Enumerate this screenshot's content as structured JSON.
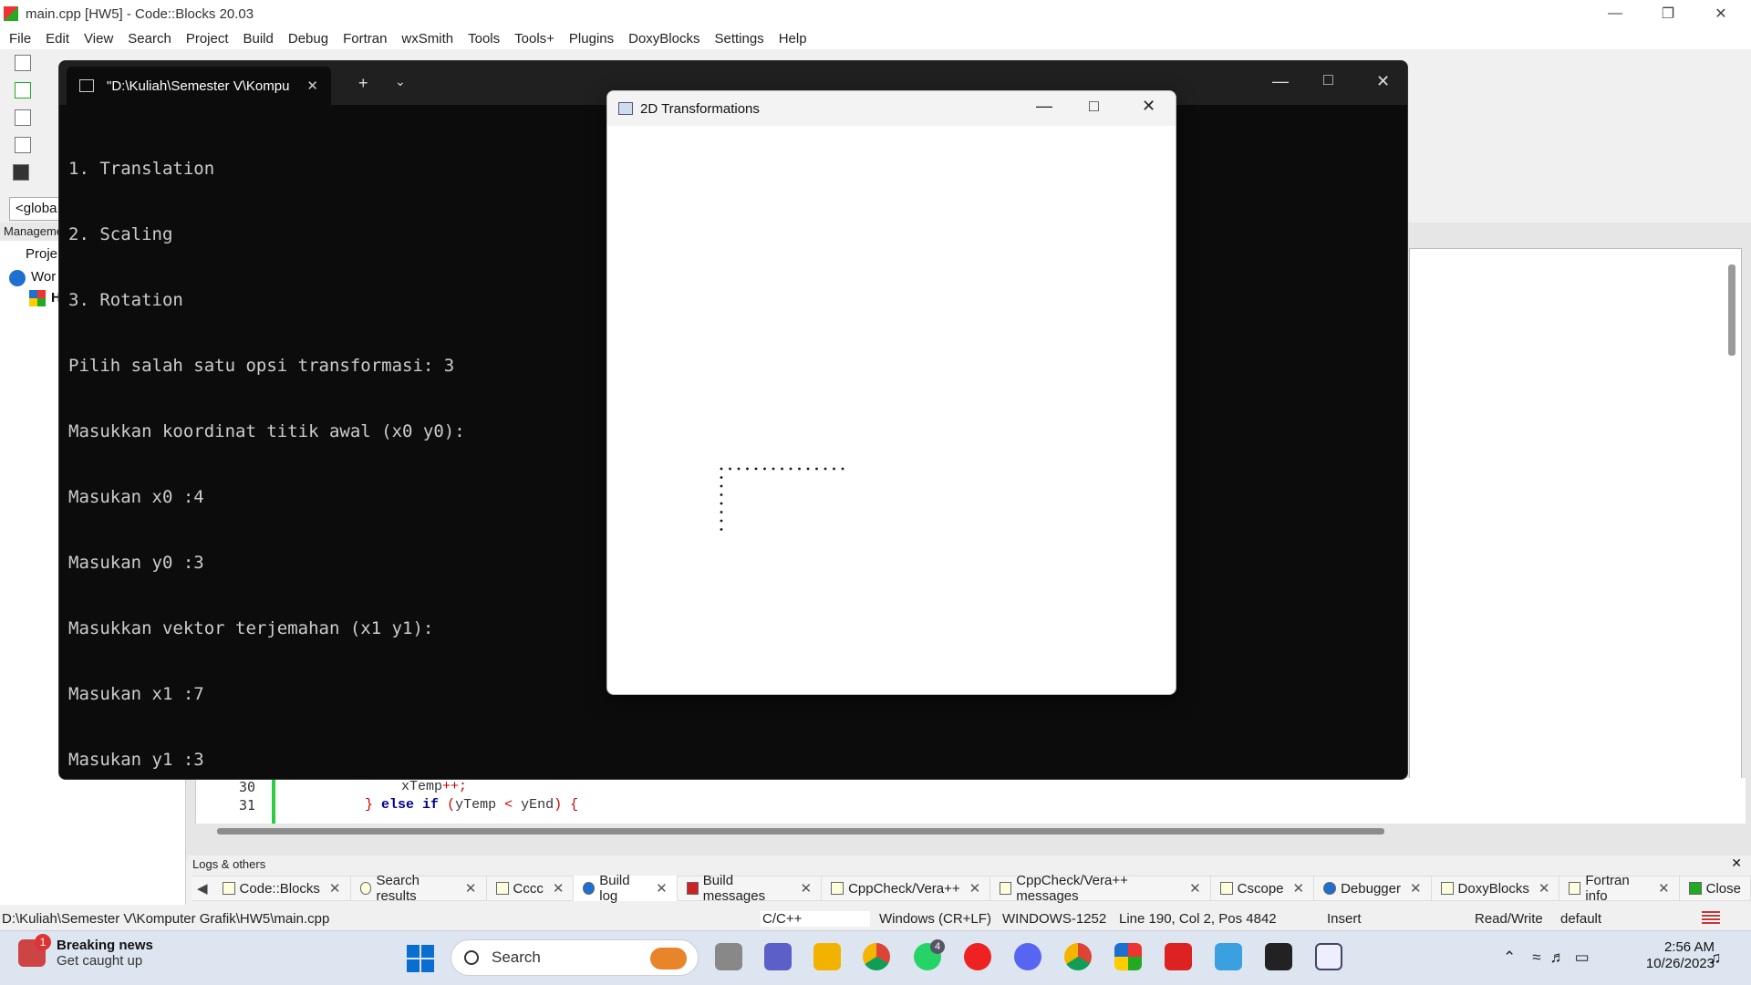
{
  "codeblocks": {
    "title": "main.cpp [HW5] - Code::Blocks 20.03",
    "menu": [
      "File",
      "Edit",
      "View",
      "Search",
      "Project",
      "Build",
      "Debug",
      "Fortran",
      "wxSmith",
      "Tools",
      "Tools+",
      "Plugins",
      "DoxyBlocks",
      "Settings",
      "Help"
    ],
    "scope_dropdown": "<globa",
    "management_label": "Manageme",
    "projects_tab": "Proje",
    "workspace_label": "Wor",
    "project_node": "H",
    "code_lines": [
      {
        "num": "30",
        "text": "xTemp++;"
      },
      {
        "num": "31",
        "text": "} else if (yTemp < yEnd) {"
      }
    ],
    "logs_title": "Logs & others",
    "log_tabs": [
      "Code::Blocks",
      "Search results",
      "Cccc",
      "Build log",
      "Build messages",
      "CppCheck/Vera++",
      "CppCheck/Vera++ messages",
      "Cscope",
      "Debugger",
      "DoxyBlocks",
      "Fortran info",
      "Close"
    ],
    "status": {
      "path": "D:\\Kuliah\\Semester V\\Komputer Grafik\\HW5\\main.cpp",
      "lang": "C/C++",
      "eol": "Windows (CR+LF)",
      "encoding": "WINDOWS-1252",
      "position": "Line 190, Col 2, Pos 4842",
      "mode": "Insert",
      "access": "Read/Write",
      "profile": "default"
    }
  },
  "terminal": {
    "tab_title": "\"D:\\Kuliah\\Semester V\\Kompu",
    "lines": [
      "1. Translation",
      "2. Scaling",
      "3. Rotation",
      "Pilih salah satu opsi transformasi: 3",
      "Masukkan koordinat titik awal (x0 y0):",
      "Masukan x0 :4",
      "Masukan y0 :3",
      "Masukkan vektor terjemahan (x1 y1):",
      "Masukan x1 :7",
      "Masukan y1 :3"
    ]
  },
  "graphics_window": {
    "title": "2D Transformations",
    "horizontal_dots": 15,
    "vertical_dots": 8
  },
  "taskbar": {
    "news_title": "Breaking news",
    "news_sub": "Get caught up",
    "news_badge": "1",
    "search_label": "Search",
    "whatsapp_badge": "4",
    "time": "2:56 AM",
    "date": "10/26/2023"
  }
}
